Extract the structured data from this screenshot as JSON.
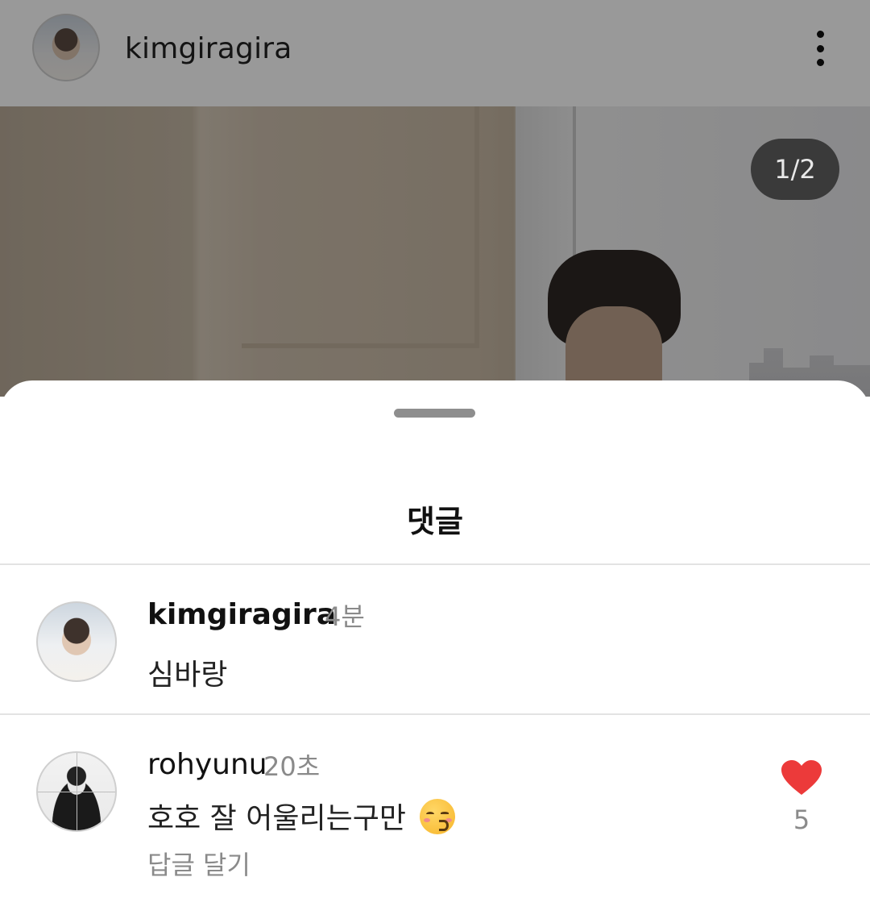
{
  "post": {
    "username": "kimgiragira",
    "photo_counter": "1/2"
  },
  "sheet": {
    "title": "댓글"
  },
  "comments": [
    {
      "username": "kimgiragira",
      "time": "4분",
      "text": "심바랑"
    },
    {
      "username": "rohyunu",
      "time": "20초",
      "text": "호호 잘 어울리는구만",
      "emoji": "kissing-face-with-smiling-eyes-icon",
      "reply_label": "답글 달기",
      "like_count": "5",
      "liked": true
    }
  ],
  "colors": {
    "like_red": "#ec3a3a",
    "secondary_text": "#8a8a8a"
  }
}
